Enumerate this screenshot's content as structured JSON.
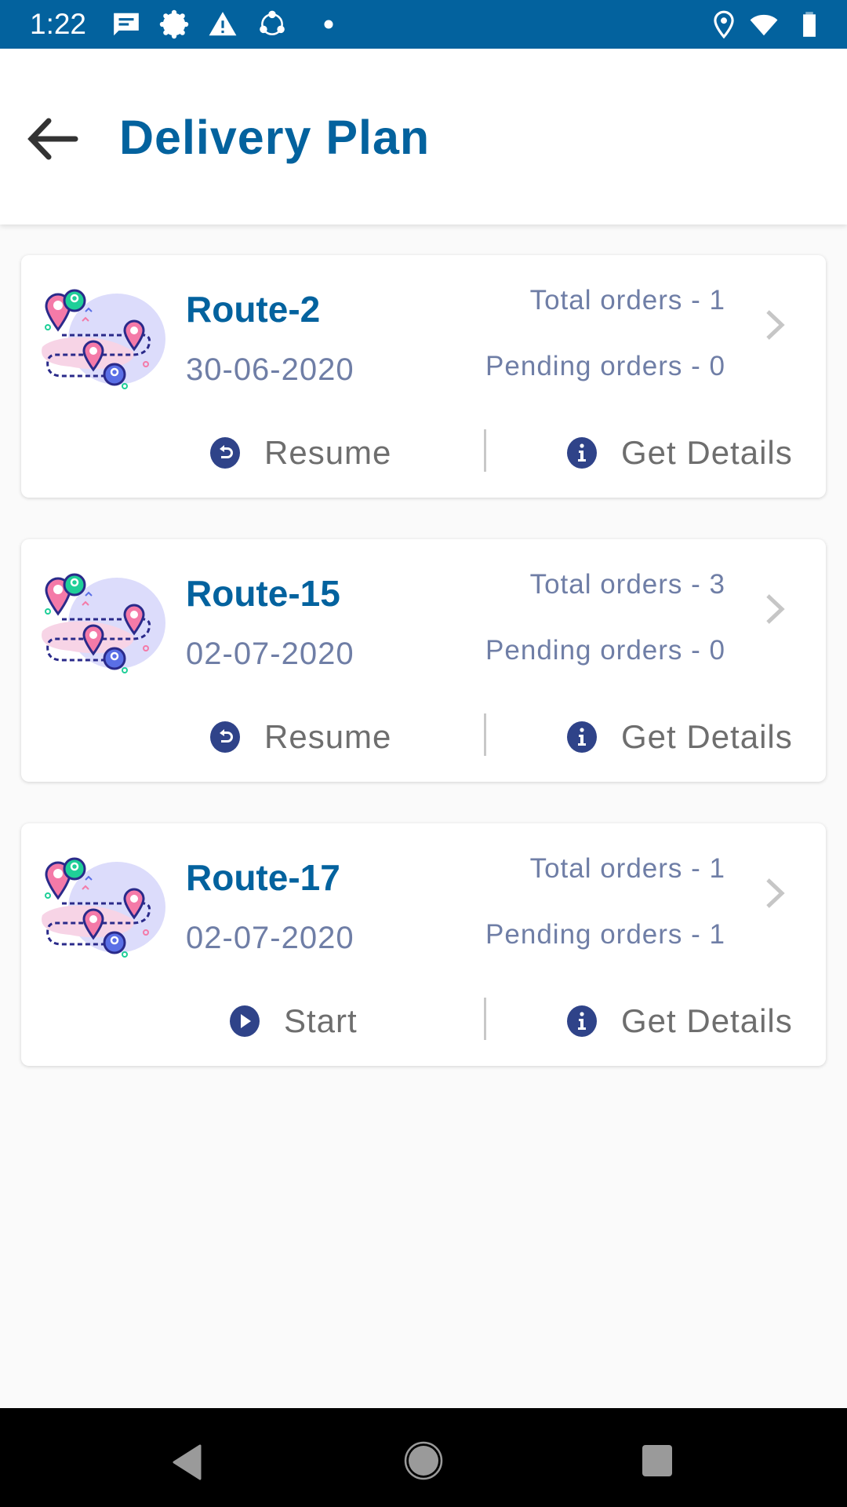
{
  "status_bar": {
    "time": "1:22",
    "left_icons": [
      "message-icon",
      "settings-badge-icon",
      "warning-icon",
      "share-it-icon",
      "dot-icon"
    ],
    "right_icons": [
      "location-icon",
      "wifi-icon",
      "battery-icon"
    ],
    "color": "#03629e"
  },
  "header": {
    "back_icon": "arrow-left-icon",
    "title": "Delivery Plan"
  },
  "routes": [
    {
      "name": "Route-2",
      "date": "30-06-2020",
      "total_orders": "Total orders - 1",
      "pending_orders": "Pending orders - 0",
      "primary_action": {
        "label": "Resume",
        "icon": "resume-icon"
      },
      "secondary_action": {
        "label": "Get Details",
        "icon": "info-icon"
      }
    },
    {
      "name": "Route-15",
      "date": "02-07-2020",
      "total_orders": "Total orders - 3",
      "pending_orders": "Pending orders - 0",
      "primary_action": {
        "label": "Resume",
        "icon": "resume-icon"
      },
      "secondary_action": {
        "label": "Get Details",
        "icon": "info-icon"
      }
    },
    {
      "name": "Route-17",
      "date": "02-07-2020",
      "total_orders": "Total orders - 1",
      "pending_orders": "Pending orders - 1",
      "primary_action": {
        "label": "Start",
        "icon": "play-icon"
      },
      "secondary_action": {
        "label": "Get Details",
        "icon": "info-icon"
      }
    }
  ],
  "nav_bar": {
    "buttons": [
      "back-triangle-icon",
      "home-circle-icon",
      "recents-square-icon"
    ]
  },
  "colors": {
    "brand": "#03629e",
    "secondary_text": "#6f7ea6",
    "action_icon": "#2f4389",
    "action_text": "#6e6e6e"
  }
}
